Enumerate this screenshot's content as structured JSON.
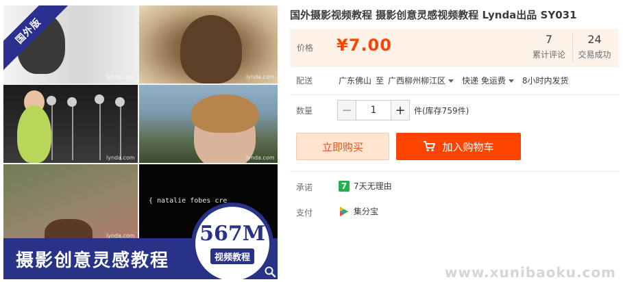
{
  "image": {
    "ribbon_text": "国外版",
    "watermarks": [
      "lynda.com",
      "lynda.com",
      "lynda.com",
      "lynda.com",
      "lynda.com"
    ],
    "tile_caption": "{ natalie fobes  cre",
    "banner_title": "摄影创意灵感教程",
    "badge_size": "567M",
    "badge_label": "视频教程",
    "zoom_icon": "search-icon"
  },
  "product": {
    "title": "国外摄影视频教程 摄影创意灵感视频教程 Lynda出品 SY031"
  },
  "price": {
    "label": "价格",
    "value": "¥7.00",
    "reviews_count": "7",
    "reviews_label": "累计评论",
    "sales_count": "24",
    "sales_label": "交易成功"
  },
  "shipping": {
    "label": "配送",
    "from": "广东佛山",
    "to_word": "至",
    "destination": "广西柳州柳江区",
    "method": "快递 免运费",
    "dispatch": "8小时内发货"
  },
  "quantity": {
    "label": "数量",
    "minus": "−",
    "value": "1",
    "plus": "+",
    "stock_text": "件(库存759件)"
  },
  "actions": {
    "buy_now": "立即购买",
    "add_to_cart": "加入购物车"
  },
  "promise": {
    "label": "承诺",
    "icon_text": "7",
    "text": "7天无理由"
  },
  "payment": {
    "label": "支付",
    "text": "集分宝"
  },
  "colors": {
    "accent": "#ff4400",
    "banner": "#283286",
    "price_bg": "#fff2e8"
  },
  "site_watermark": "www.xunibaoku.com"
}
